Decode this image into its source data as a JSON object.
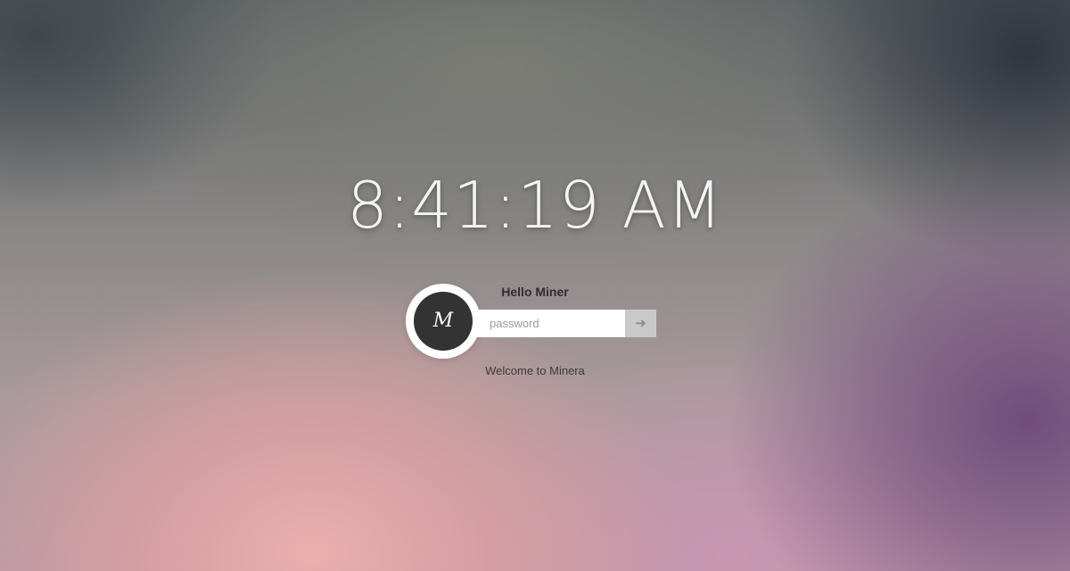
{
  "lockscreen": {
    "time": "8:41:19 AM",
    "greeting": "Hello Miner",
    "avatar_letter": "M",
    "password_placeholder": "password",
    "submit_icon": "arrow-right-icon",
    "submit_glyph": "➜",
    "welcome": "Welcome to Minera"
  },
  "colors": {
    "avatar_bg": "#333333",
    "submit_bg": "#c9c9c9",
    "text_light": "#f4f4f4"
  }
}
